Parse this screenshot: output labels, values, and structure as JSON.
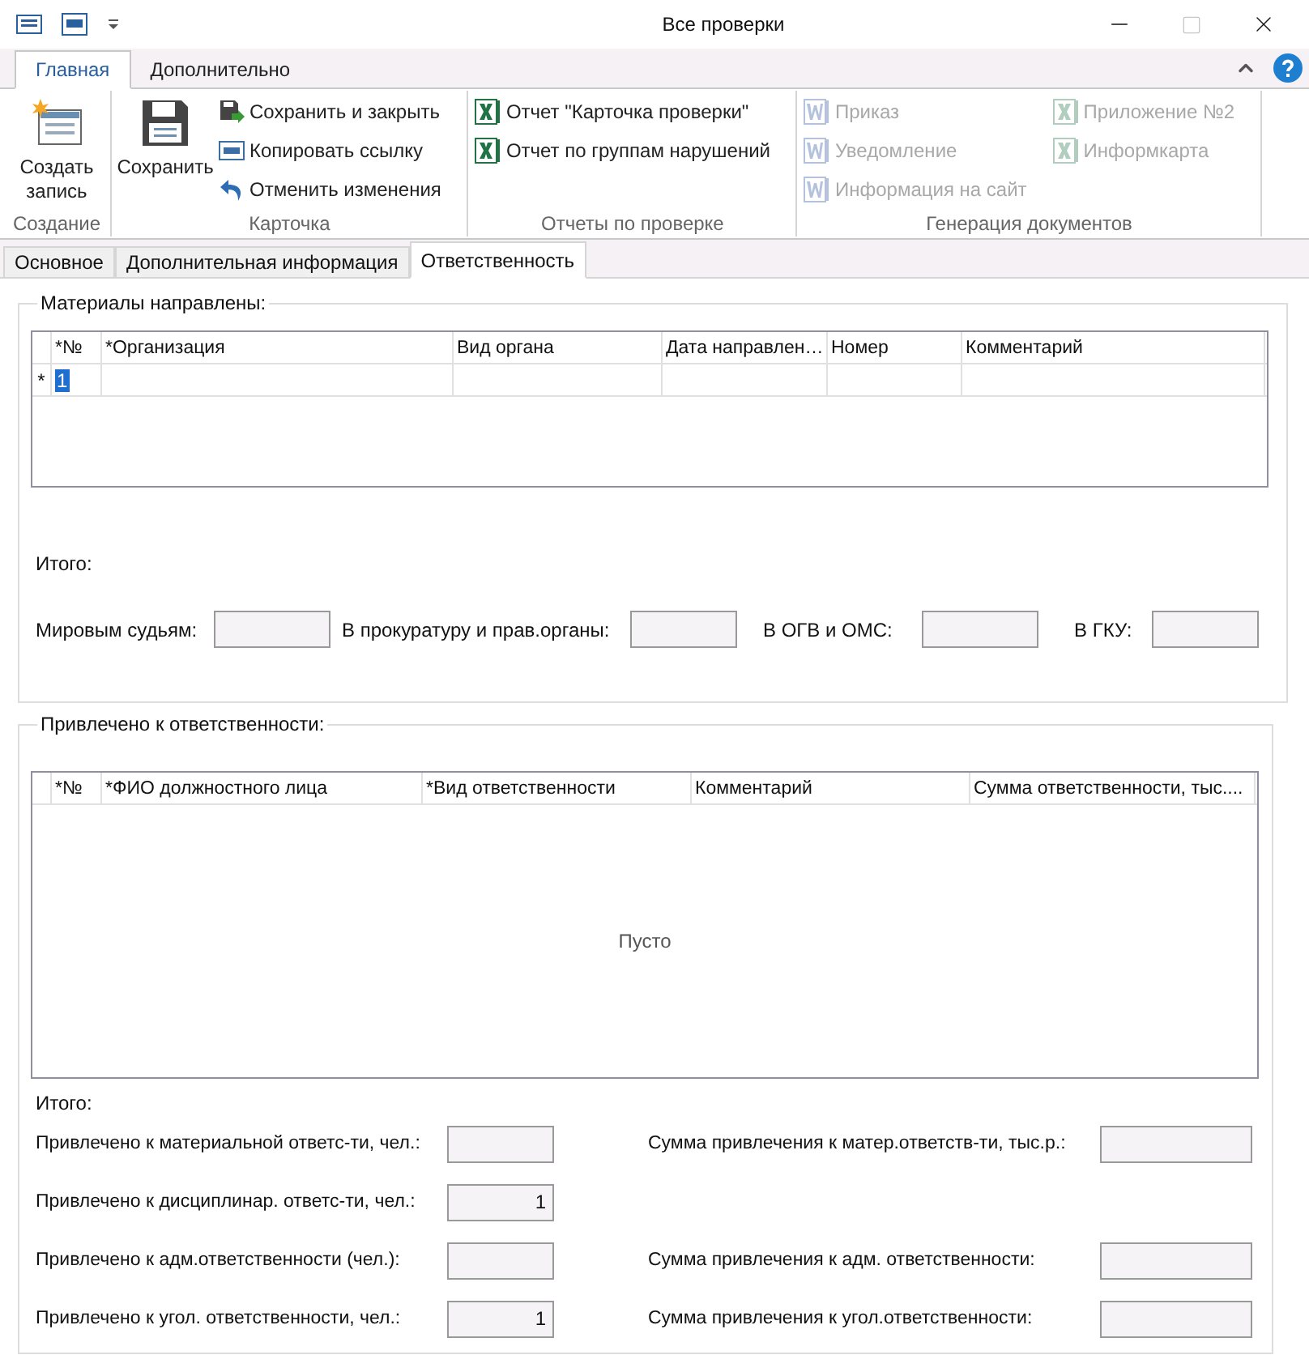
{
  "window": {
    "title": "Все проверки"
  },
  "ribbon_tabs": [
    {
      "label": "Главная",
      "selected": true
    },
    {
      "label": "Дополнительно",
      "selected": false
    }
  ],
  "ribbon_groups": [
    {
      "label": "Создание",
      "items": [
        {
          "kind": "large",
          "label": "Создать запись",
          "disabled": false
        }
      ]
    },
    {
      "label": "Карточка",
      "items": [
        {
          "kind": "large",
          "label": "Сохранить",
          "disabled": false
        },
        {
          "kind": "small",
          "label": "Сохранить и закрыть",
          "disabled": false
        },
        {
          "kind": "small",
          "label": "Копировать ссылку",
          "disabled": false
        },
        {
          "kind": "small",
          "label": "Отменить изменения",
          "disabled": false
        }
      ]
    },
    {
      "label": "Отчеты по проверке",
      "items": [
        {
          "kind": "small",
          "label": "Отчет \"Карточка проверки\"",
          "disabled": false
        },
        {
          "kind": "small",
          "label": "Отчет по группам нарушений",
          "disabled": false
        }
      ]
    },
    {
      "label": "Генерация документов",
      "items": [
        {
          "kind": "small",
          "label": "Приказ",
          "disabled": true
        },
        {
          "kind": "small",
          "label": "Уведомление",
          "disabled": true
        },
        {
          "kind": "small",
          "label": "Информация на сайт",
          "disabled": true
        },
        {
          "kind": "small",
          "label": "Приложение №2",
          "disabled": true
        },
        {
          "kind": "small",
          "label": "Информкарта",
          "disabled": true
        }
      ]
    }
  ],
  "form_tabs": [
    {
      "label": "Основное",
      "selected": false
    },
    {
      "label": "Дополнительная информация",
      "selected": false
    },
    {
      "label": "Ответственность",
      "selected": true
    }
  ],
  "materials": {
    "title": "Материалы направлены:",
    "columns": [
      "*№",
      "*Организация",
      "Вид органа",
      "Дата направлен…",
      "Номер",
      "Комментарий"
    ],
    "new_row": {
      "marker": "*",
      "cells": [
        "1"
      ]
    },
    "totals_label": "Итого:",
    "fields": [
      {
        "label": "Мировым судьям:"
      },
      {
        "label": "В прокуратуру и прав.органы:"
      },
      {
        "label": "В ОГВ и ОМС:"
      },
      {
        "label": "В ГКУ:"
      }
    ]
  },
  "liability": {
    "title": "Привлечено к ответственности:",
    "columns": [
      "*№",
      "*ФИО должностного лица",
      "*Вид ответственности",
      "Комментарий",
      "Сумма ответственности, тыс...."
    ],
    "empty_text": "Пусто",
    "totals_label": "Итого:",
    "rows": [
      {
        "left": {
          "label": "Привлечено к материальной ответс-ти, чел.:"
        },
        "right": {
          "label": "Сумма привлечения к матер.ответств-ти, тыс.р.:"
        }
      },
      {
        "left": {
          "label": "Привлечено к дисциплинар. ответс-ти, чел.:",
          "value": "1"
        }
      },
      {
        "left": {
          "label": "Привлечено к адм.ответственности (чел.):"
        },
        "right": {
          "label": "Сумма привлечения к адм. ответственности:"
        }
      },
      {
        "left": {
          "label": "Привлечено к угол. ответственности, чел.:",
          "value": "1"
        },
        "right": {
          "label": "Сумма привлечения к угол.ответственности:"
        }
      }
    ]
  }
}
